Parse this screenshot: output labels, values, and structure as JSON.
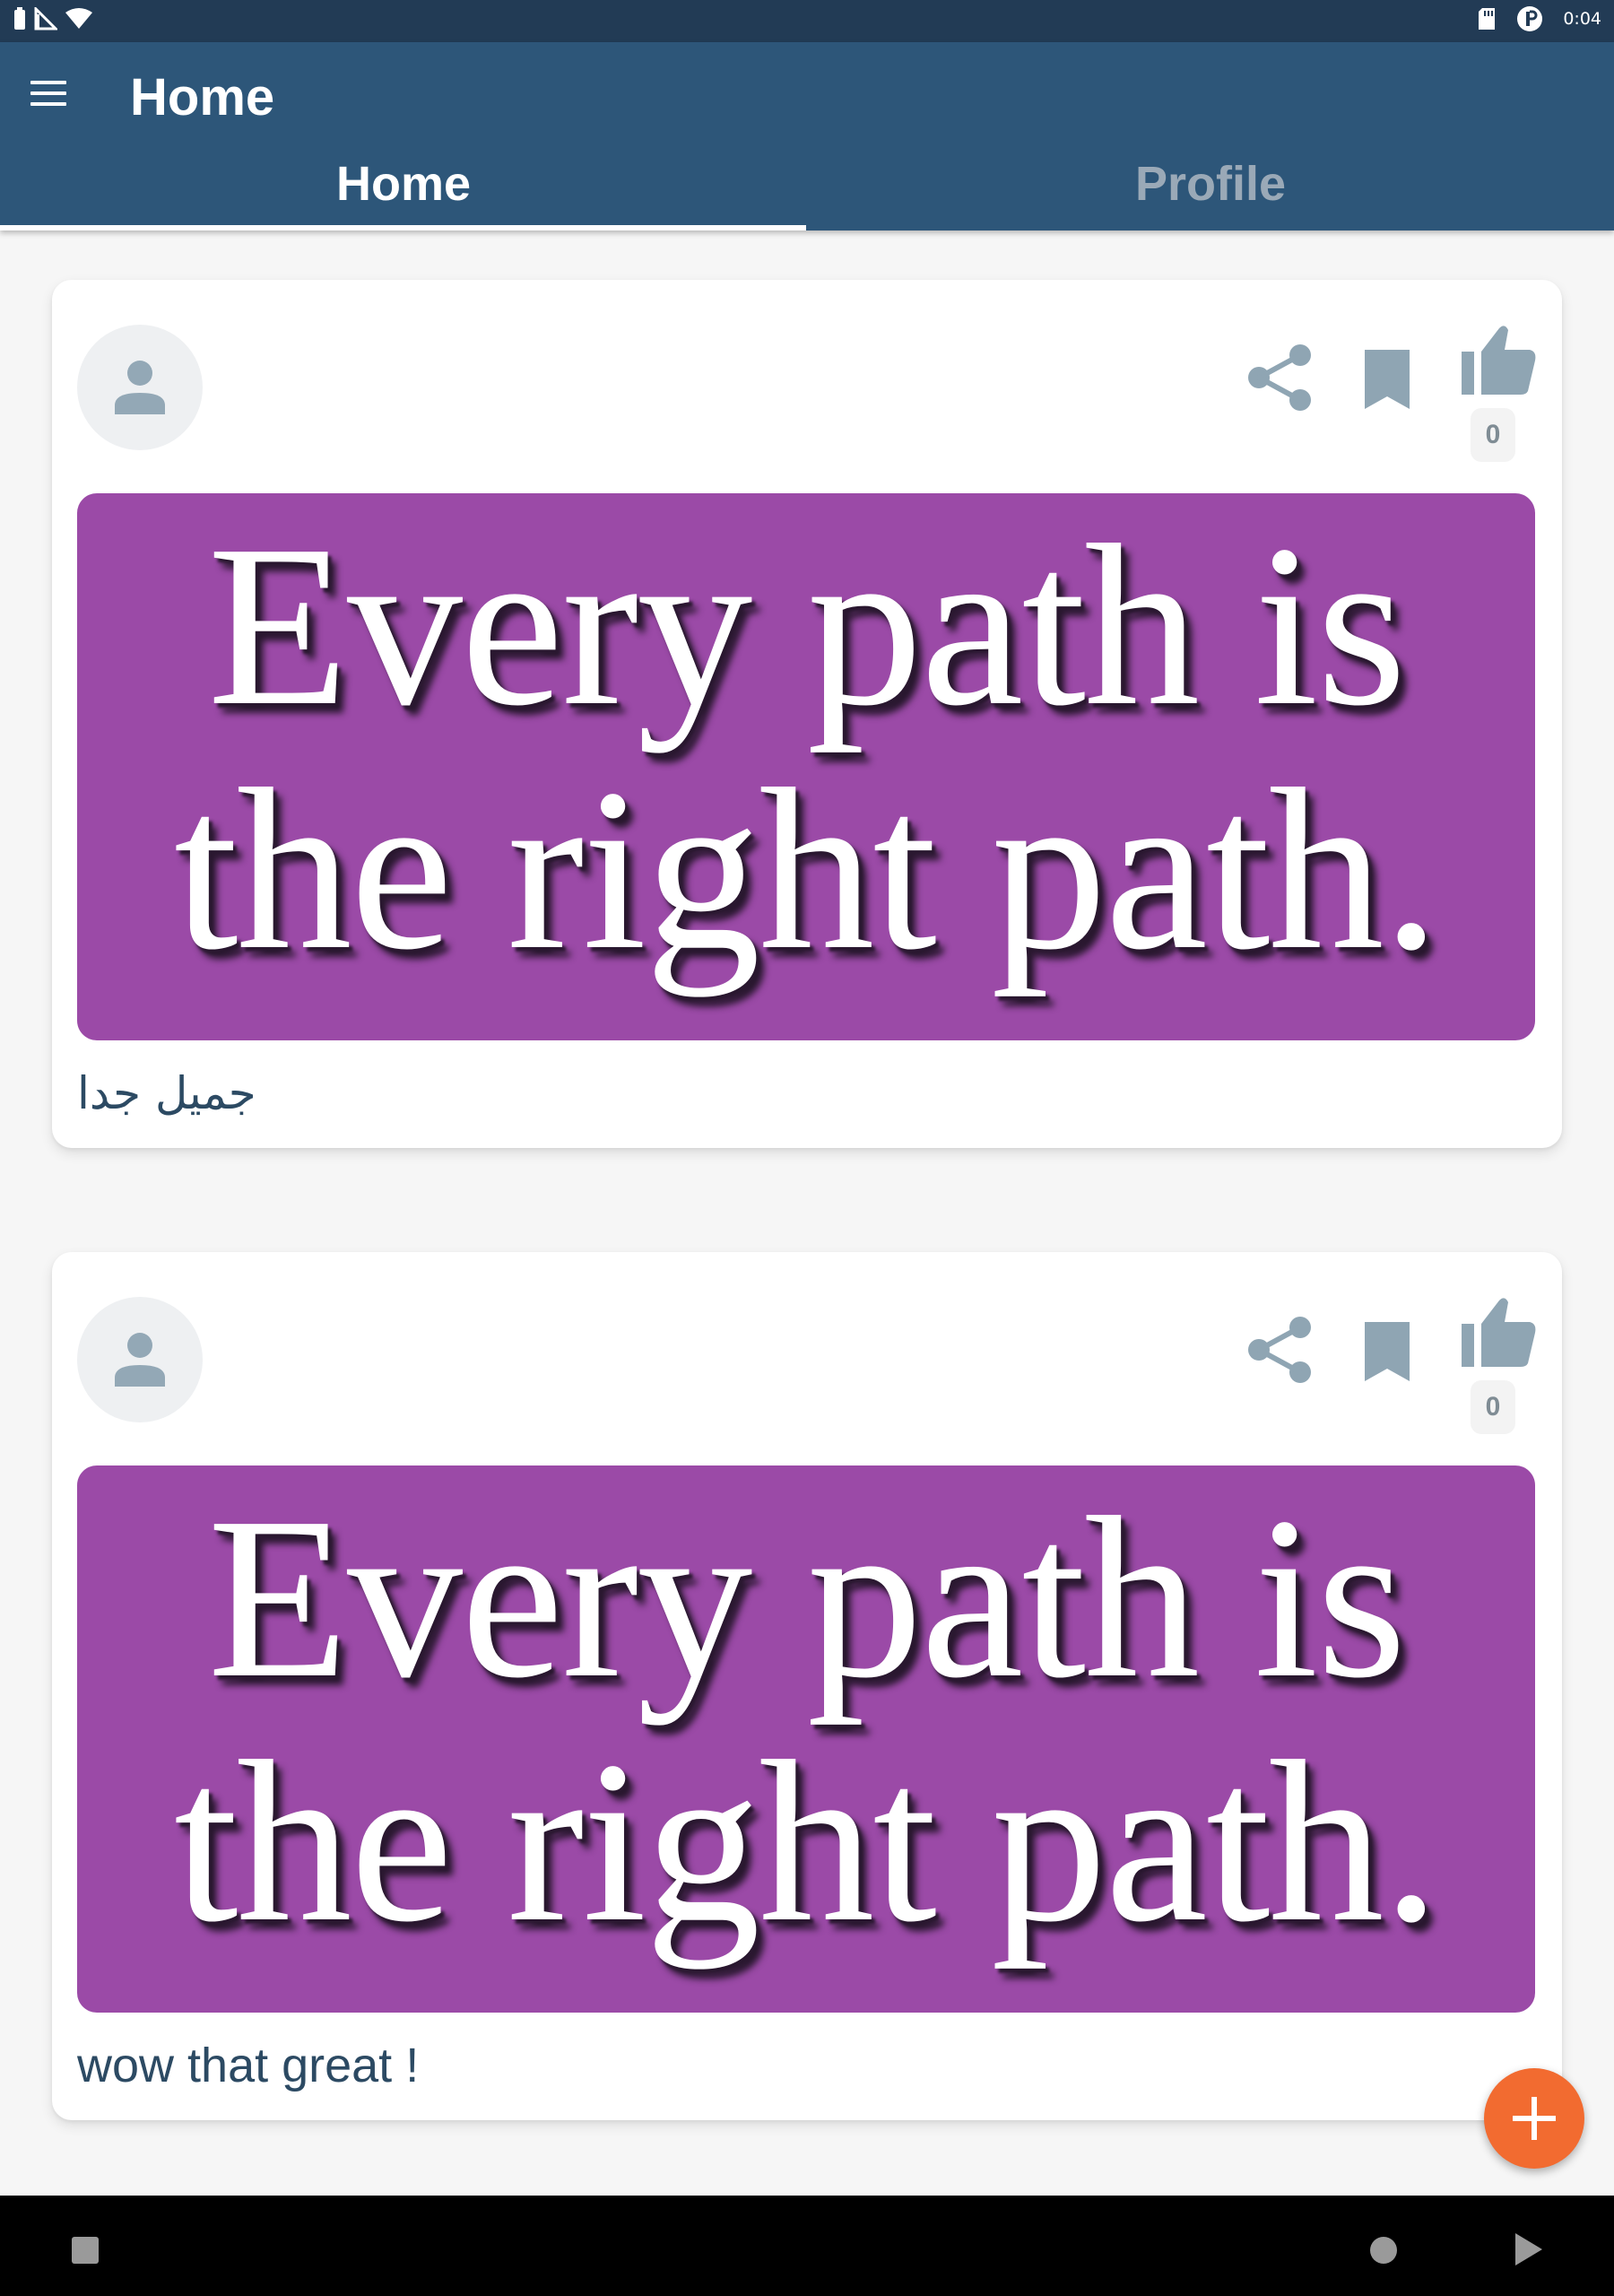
{
  "status_bar": {
    "time": "0:04",
    "icons": [
      "battery-icon",
      "no-signal-icon",
      "wifi-icon",
      "sd-card-icon",
      "notification-icon"
    ]
  },
  "app_bar": {
    "title": "Home",
    "menu_icon": "menu-icon"
  },
  "tabs": [
    {
      "label": "Home",
      "selected": true
    },
    {
      "label": "Profile",
      "selected": false
    }
  ],
  "colors": {
    "status_bar": "#223b55",
    "app_bar": "#2d5679",
    "accent_fab": "#f26b30",
    "post_image_bg": "#9b4aa7",
    "caption_text": "#2c4a63",
    "icon_gray": "#8fa5b3"
  },
  "posts": [
    {
      "avatar_icon": "person-icon",
      "actions": [
        "share-icon",
        "bookmark-icon",
        "thumbs-up-icon"
      ],
      "like_count": "0",
      "image_text": {
        "line1": "Every path is",
        "line2": "the right path."
      },
      "caption": "جميل جدا"
    },
    {
      "avatar_icon": "person-icon",
      "actions": [
        "share-icon",
        "bookmark-icon",
        "thumbs-up-icon"
      ],
      "like_count": "0",
      "image_text": {
        "line1": "Every path is",
        "line2": "the right path."
      },
      "caption": "wow that great !"
    }
  ],
  "fab": {
    "icon": "plus-icon"
  },
  "nav_bar": {
    "icons": [
      "recent-apps-icon",
      "home-icon",
      "back-icon"
    ]
  }
}
